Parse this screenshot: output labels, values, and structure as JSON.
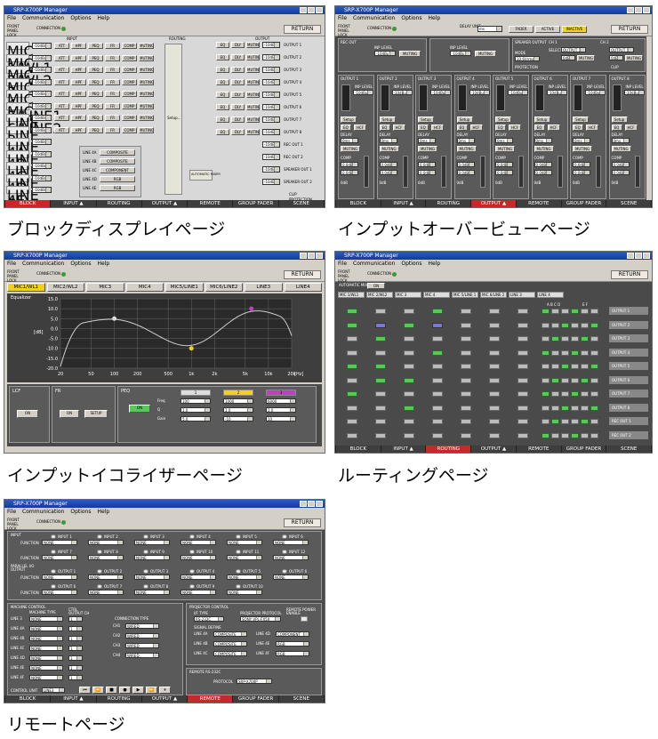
{
  "window": {
    "title": "SRP-X700P Manager",
    "menu": [
      "File",
      "Communication",
      "Options",
      "Help"
    ],
    "front_panel": "FRONT PANEL LOCK",
    "connection": "CONNECTION",
    "return_label": "RETURN"
  },
  "tabs": {
    "labels": [
      "BLOCK",
      "INPUT ▲",
      "ROUTING",
      "OUTPUT ▲",
      "REMOTE",
      "GROUP FADER",
      "SCENE"
    ]
  },
  "captions": {
    "block": "ブロックディスプレイページ",
    "overview": "インプットオーバービューページ",
    "equalizer": "インプットイコライザーページ",
    "routing": "ルーティングページ",
    "remote": "リモートページ"
  },
  "block": {
    "inputs": [
      "MIC 1/WL1",
      "MIC 2/WL2",
      "MIC 3",
      "MIC 4",
      "MIC 5/LINE1",
      "MIC 6/LINE2",
      "LINE 3",
      "LINE 4A",
      "LINE 4B",
      "LINE 4C",
      "LINE 4D",
      "LINE 4E",
      "LINE 4F"
    ],
    "outputs": [
      "OUTPUT 1",
      "OUTPUT 2",
      "OUTPUT 3",
      "OUTPUT 4",
      "OUTPUT 5",
      "OUTPUT 6",
      "OUTPUT 7",
      "OUTPUT 8",
      "REC OUT 1",
      "REC OUT 2",
      "SPEAKER OUT 1",
      "SPEAKER OUT 2"
    ],
    "sections": {
      "input": "INPUT",
      "routing": "ROUTING",
      "output": "OUTPUT"
    },
    "level": "-10dBu",
    "chain": [
      "ATT",
      "HPF",
      "PEQ",
      "FR",
      "COMP",
      "MUTING"
    ],
    "out_chain": [
      "EQ",
      "DLY",
      "MUTING"
    ],
    "setup": "Setup...",
    "automatic_mixer": "AUTOMATIC MIXER",
    "line4_rows": [
      [
        "LINE 4A",
        "COMPOSITE"
      ],
      [
        "LINE 4B",
        "COMPOSITE"
      ],
      [
        "LINE 4C",
        "COMPONENT"
      ],
      [
        "LINE 4D",
        "RGB"
      ],
      [
        "LINE 4E",
        "RGB"
      ]
    ],
    "clip": "CLIP",
    "protection": "PROTECTION",
    "att": "ATT"
  },
  "overview": {
    "delay_unit": "DELAY UNIT",
    "delay_unit_value": "ms",
    "fader": "FADER",
    "active": "ACTIVE",
    "inactive": "INACTIVE",
    "rec_out": "REC OUT",
    "inp_level": "INP LEVEL",
    "level_value": "-10dBu",
    "muting": "MUTING",
    "speaker_out": "SPEAKER OUTPUT",
    "mode": "MODE",
    "mode_value": "10.6Vrms",
    "protection": "PROTECTION",
    "select": "SELECT",
    "select_value": "OUTPUT 1",
    "ch": "CH 1",
    "ch2": "CH 2",
    "att_value": "0dB",
    "clip": "CLIP",
    "outputs": [
      "OUTPUT 1",
      "OUTPUT 2",
      "OUTPUT 3",
      "OUTPUT 4",
      "OUTPUT 5",
      "OUTPUT 6",
      "OUTPUT 7",
      "OUTPUT 8"
    ],
    "setup": "Setup",
    "eq": "EQ",
    "hcf": "HCF",
    "delay": "DELAY",
    "delay_value": "0ms",
    "muting2": "MUTING",
    "comp": "COMP",
    "value": "0.0dB",
    "fader_value": "0dB"
  },
  "equalizer": {
    "tabs": [
      "MIC1/WL1",
      "MIC2/WL2",
      "MIC3",
      "MIC4",
      "MIC5/LINE1",
      "MIC6/LINE2",
      "LINE3",
      "LINE4"
    ],
    "graph_title": "Equalizer",
    "y_ticks": [
      "15.0",
      "10.0",
      "5.0",
      "0.0",
      "-5.0",
      "-10.0",
      "-15.0",
      "-20.0"
    ],
    "y_unit": "[dB]",
    "x_ticks": [
      "20",
      "50",
      "100",
      "200",
      "500",
      "1k",
      "2k",
      "5k",
      "10k",
      "20k"
    ],
    "x_unit": "[Hz]",
    "lcf": "LCF",
    "fr": "FR",
    "peq": "PEQ",
    "on": "ON",
    "setup": "SETUP",
    "band_nums": [
      "1",
      "2",
      "3"
    ],
    "freq": "Freq",
    "q": "Q",
    "gain": "Gain",
    "freq_values": [
      "100",
      "1000",
      "6000"
    ],
    "q_values": [
      "1.0",
      "1.0",
      "1.0"
    ],
    "gain_values": [
      "5.0",
      "-10",
      "10"
    ]
  },
  "routing": {
    "automatic_mixer": "AUTOMATIC MIXER",
    "on": "ON",
    "inputs": [
      "MIC 1/WL1",
      "MIC 2/WL2",
      "MIC 3",
      "MIC 4",
      "MIC 5/LINE 1",
      "MIC 6/LINE 2",
      "LINE 3",
      "LINE 4"
    ],
    "bus_a": "A B C D",
    "bus_b": "E F",
    "outputs": [
      "OUTPUT 1",
      "OUTPUT 2",
      "OUTPUT 3",
      "OUTPUT 4",
      "OUTPUT 5",
      "OUTPUT 6",
      "OUTPUT 7",
      "OUTPUT 8",
      "REC OUT 1",
      "REC OUT 2"
    ]
  },
  "remote": {
    "input": "INPUT",
    "parallel_io": "PARALLEL I/O",
    "output": "OUTPUT",
    "function": "FUNCTION",
    "none": "NONE",
    "input_nums": [
      "INPUT 1",
      "INPUT 2",
      "INPUT 3",
      "INPUT 4",
      "INPUT 5",
      "INPUT 6",
      "INPUT 7",
      "INPUT 8",
      "INPUT 9",
      "INPUT 10",
      "INPUT 11",
      "INPUT 12"
    ],
    "output_nums": [
      "OUTPUT 1",
      "OUTPUT 2",
      "OUTPUT 3",
      "OUTPUT 4",
      "OUTPUT 5",
      "OUTPUT 6",
      "OUTPUT 7",
      "OUTPUT 8",
      "OUTPUT 9",
      "OUTPUT 10"
    ],
    "machine_control": "MACHINE CONTROL",
    "machine_type": "MACHINE TYPE",
    "ctrl_output": "CTRL OUTPUT CH",
    "connection_type": "CONNECTION TYPE",
    "lines": [
      "LINE 3",
      "LINE 4A",
      "LINE 4B",
      "LINE 4C",
      "LINE 4D",
      "LINE 4E",
      "LINE 4F"
    ],
    "ch_labels": [
      "CH1",
      "CH2",
      "CH3",
      "CH4"
    ],
    "wired": "WIRED",
    "one": "1",
    "control_unit": "CONTROL UNIT",
    "control_unit_value": "LINE3",
    "projector_control": "PROJECTOR CONTROL",
    "i_f_type": "I/F TYPE",
    "i_f_value": "RS-232C",
    "proj_protocol": "PROJECTOR PROTOCOL",
    "proj_protocol_value": "SONY VPL-FX50",
    "remote_power": "REMOTE POWER ENABLE",
    "signal_define": "SIGNAL DEFINE",
    "sig_lines": [
      "LINE 4A",
      "LINE 4B",
      "LINE 4C",
      "LINE 4D",
      "LINE 4E",
      "LINE 4F"
    ],
    "sig_values": [
      "COMPOSITE",
      "COMPOSITE",
      "COMPOSITE",
      "COMPONENT",
      "RGB",
      "RGB"
    ],
    "remote_rs": "REMOTE RS-232C",
    "protocol": "PROTOCOL",
    "protocol_value": "SRP-X700P"
  },
  "colors": {
    "active_tab": "#c8282a",
    "panel": "#4a4a4a",
    "led_green": "#58c858",
    "eq_mark1": "#dddddd",
    "eq_mark2": "#f0d020",
    "eq_mark3": "#c040c0"
  }
}
